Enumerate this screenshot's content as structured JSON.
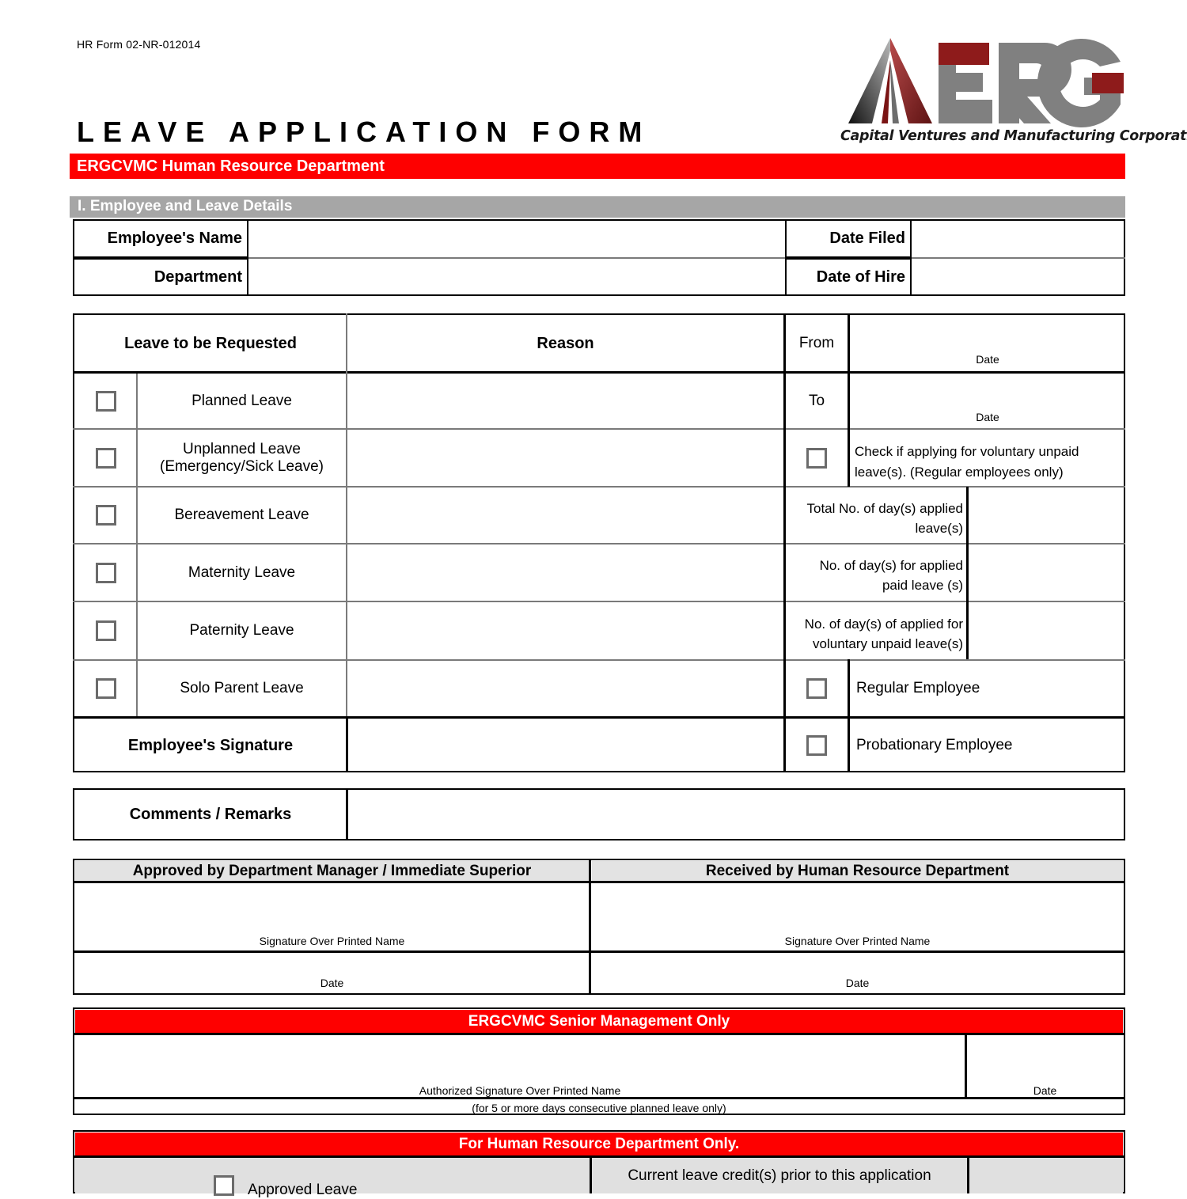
{
  "header": {
    "form_code": "HR Form 02-NR-012014",
    "title": "LEAVE APPLICATION FORM",
    "red_banner": "ERGCVMC Human Resource Department",
    "logo_text": "ERG",
    "logo_tagline": "Capital Ventures and Manufacturing Corporation"
  },
  "section_one": {
    "band": "I. Employee and Leave Details",
    "employee_name_label": "Employee's Name",
    "employee_name_value": "",
    "department_label": "Department",
    "department_value": "",
    "date_filed_label": "Date Filed",
    "date_filed_value": "",
    "date_of_hire_label": "Date of Hire",
    "date_of_hire_value": ""
  },
  "leave_table": {
    "col_leave": "Leave to be Requested",
    "col_reason": "Reason",
    "from_label": "From",
    "to_label": "To",
    "date_label_from": "Date",
    "date_label_to": "Date",
    "from_value": "",
    "to_value": "",
    "rows": [
      {
        "label": "Planned Leave",
        "reason": ""
      },
      {
        "label": "Unplanned Leave",
        "label2": "(Emergency/Sick Leave)",
        "reason": ""
      },
      {
        "label": "Bereavement Leave",
        "reason": ""
      },
      {
        "label": "Maternity Leave",
        "reason": ""
      },
      {
        "label": "Paternity Leave",
        "reason": ""
      },
      {
        "label": "Solo Parent Leave",
        "reason": ""
      }
    ],
    "voluntary_unpaid_note_l1": "Check if applying for voluntary unpaid",
    "voluntary_unpaid_note_l2": "leave(s). (Regular employees only)",
    "total_days_l1": "Total No. of day(s) applied",
    "total_days_l2": "leave(s)",
    "total_days_value": "",
    "paid_days_l1": "No. of day(s) for applied",
    "paid_days_l2": "paid leave (s)",
    "paid_days_value": "",
    "unpaid_days_l1": "No. of day(s) of applied for",
    "unpaid_days_l2": "voluntary unpaid leave(s)",
    "unpaid_days_value": "",
    "regular_employee": "Regular Employee",
    "probationary_employee": "Probationary Employee",
    "employee_signature_label": "Employee's Signature",
    "employee_signature_value": ""
  },
  "comments": {
    "label": "Comments / Remarks",
    "value": ""
  },
  "approvals": {
    "left_header": "Approved by Department Manager / Immediate Superior",
    "right_header": "Received by Human Resource Department",
    "signature_caption": "Signature Over Printed Name",
    "date_caption": "Date",
    "left_signature_value": "",
    "right_signature_value": "",
    "left_date_value": "",
    "right_date_value": ""
  },
  "senior_management": {
    "banner": "ERGCVMC Senior Management Only",
    "signature_caption": "Authorized Signature Over Printed Name",
    "date_caption": "Date",
    "footnote": "(for 5 or more days consecutive planned leave only)",
    "signature_value": "",
    "date_value": ""
  },
  "hr_only": {
    "banner": "For Human Resource Department Only.",
    "approved_leave": "Approved Leave",
    "current_credits": "Current leave credit(s) prior to this application",
    "current_credits_value": ""
  },
  "colors": {
    "red": "#fe0000",
    "band_gray": "#a6a6a6",
    "header_gray": "#e3e3e3",
    "checkbox_border": "#6b6b6b",
    "logo_gray": "#808080",
    "logo_dark_red": "#8e1b1b"
  }
}
